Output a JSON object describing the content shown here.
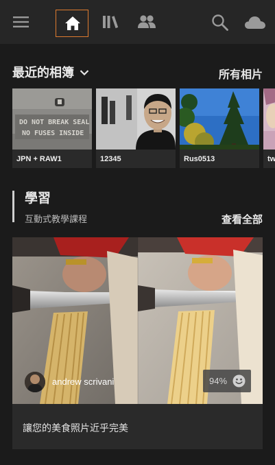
{
  "topbar": {
    "icons": [
      "menu-icon",
      "home-icon",
      "library-icon",
      "people-icon",
      "search-icon",
      "cloud-icon"
    ],
    "accent_color": "#e07c2f"
  },
  "recent": {
    "title": "最近的相簿",
    "all_photos": "所有相片",
    "albums": [
      {
        "label": "JPN + RAW1"
      },
      {
        "label": "12345"
      },
      {
        "label": "Rus0513"
      },
      {
        "label": "tw"
      }
    ]
  },
  "learn": {
    "title": "學習",
    "subtitle": "互動式教學課程",
    "see_all": "查看全部",
    "tutorial": {
      "author": "andrew scrivani",
      "score": "94%",
      "description": "讓您的美食照片近乎完美"
    }
  }
}
